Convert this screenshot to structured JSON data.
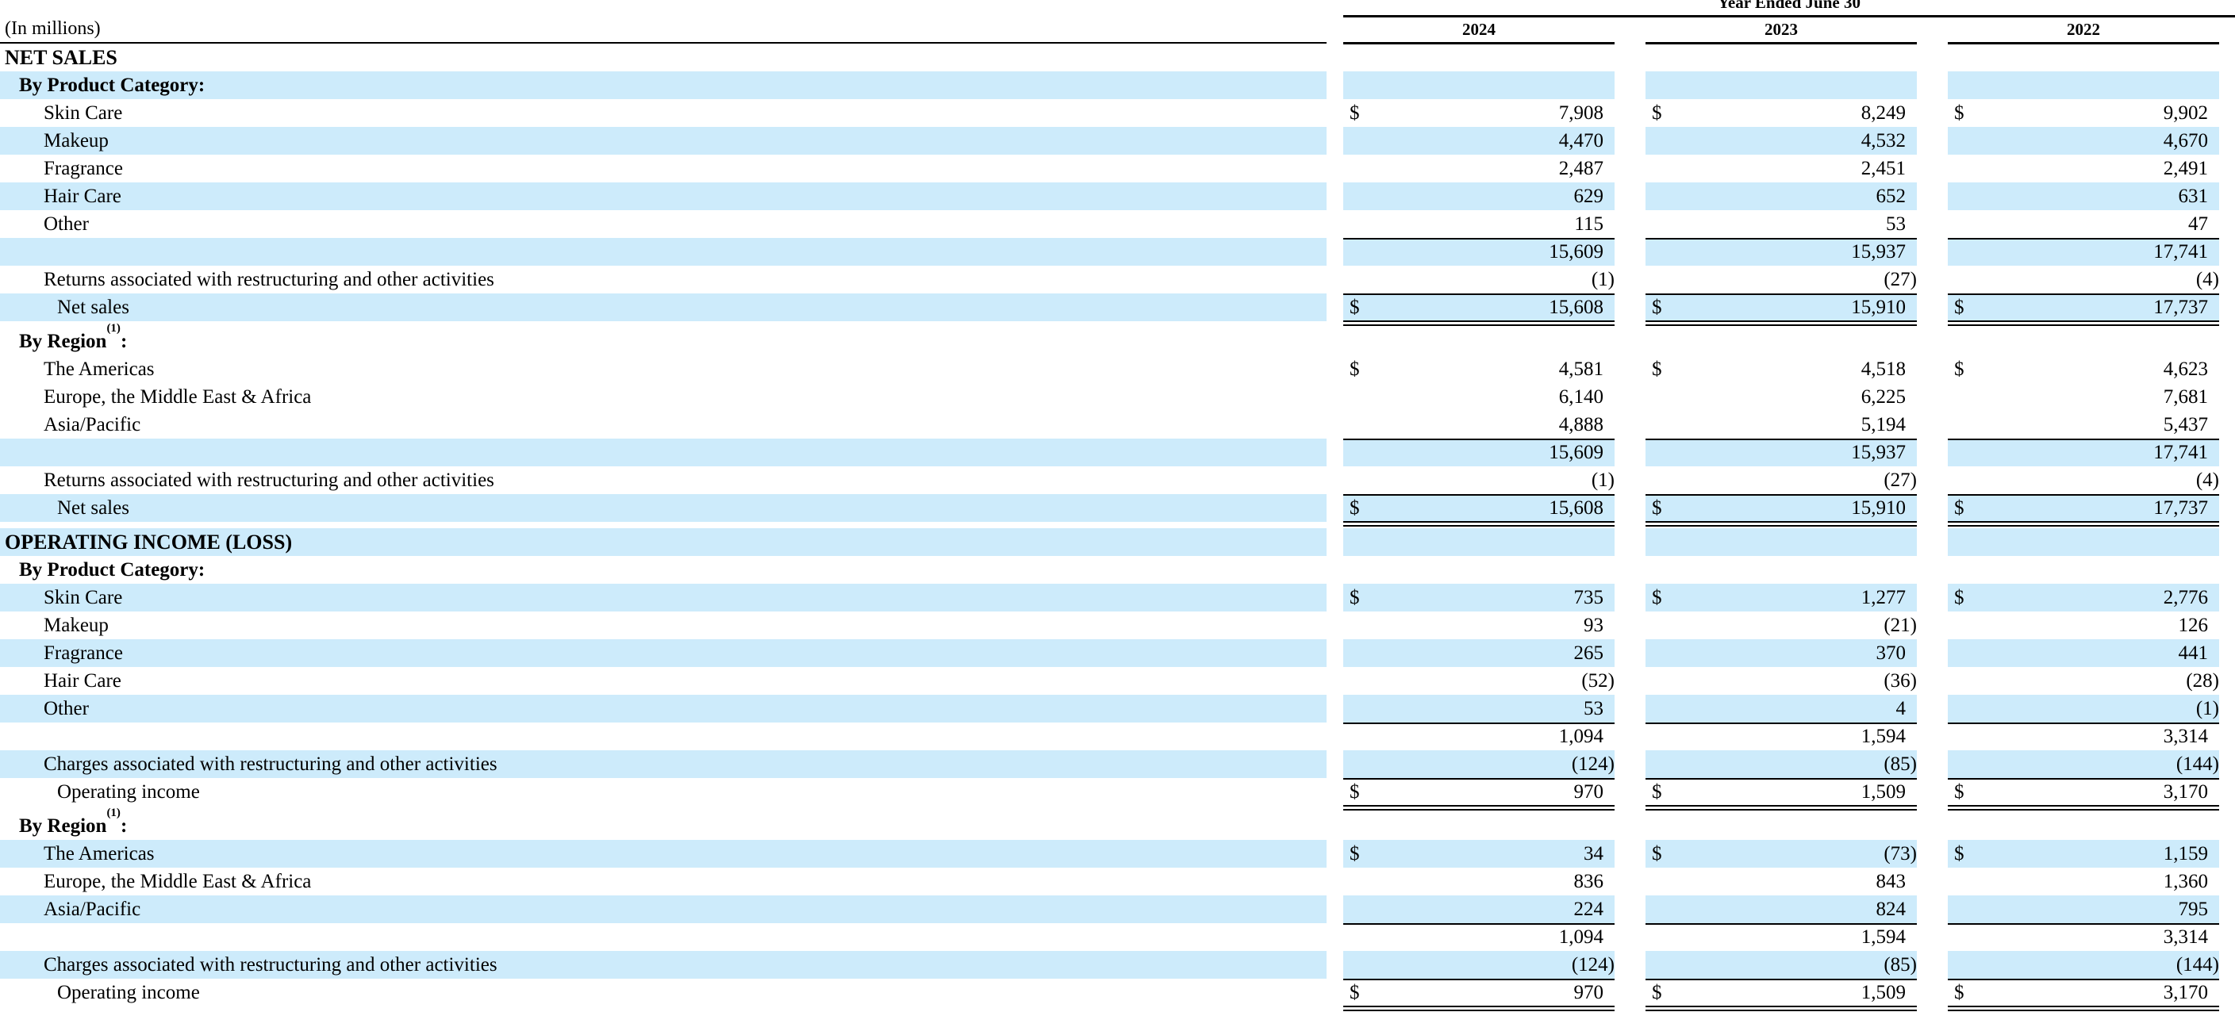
{
  "header": {
    "period_label": "Year Ended June 30",
    "unit_note": "(In millions)",
    "years": [
      "2024",
      "2023",
      "2022"
    ]
  },
  "rows": [
    {
      "type": "section",
      "label": "NET SALES",
      "shade": false
    },
    {
      "type": "subheader",
      "label": "By Product Category:",
      "shade": true
    },
    {
      "type": "item",
      "label": "Skin Care",
      "shade": false,
      "dollar": true,
      "values": [
        "7,908",
        "8,249",
        "9,902"
      ]
    },
    {
      "type": "item",
      "label": "Makeup",
      "shade": true,
      "values": [
        "4,470",
        "4,532",
        "4,670"
      ]
    },
    {
      "type": "item",
      "label": "Fragrance",
      "shade": false,
      "values": [
        "2,487",
        "2,451",
        "2,491"
      ]
    },
    {
      "type": "item",
      "label": "Hair Care",
      "shade": true,
      "values": [
        "629",
        "652",
        "631"
      ]
    },
    {
      "type": "item",
      "label": "Other",
      "shade": false,
      "values": [
        "115",
        "53",
        "47"
      ]
    },
    {
      "type": "item",
      "label": "",
      "shade": true,
      "rule_top": true,
      "values": [
        "15,609",
        "15,937",
        "17,741"
      ]
    },
    {
      "type": "item",
      "label": "Returns associated with restructuring and other activities",
      "shade": false,
      "values": [
        "(1)",
        "(27)",
        "(4)"
      ]
    },
    {
      "type": "total",
      "label": "Net sales",
      "shade": true,
      "dollar": true,
      "rule_top": true,
      "double": true,
      "values": [
        "15,608",
        "15,910",
        "17,737"
      ]
    },
    {
      "type": "subheader",
      "label": "By Region",
      "sup": "(1)",
      "suffix": ":",
      "shade": false
    },
    {
      "type": "item",
      "label": "The Americas",
      "shade": false,
      "dollar": true,
      "values": [
        "4,581",
        "4,518",
        "4,623"
      ]
    },
    {
      "type": "item",
      "label": "Europe, the Middle East & Africa",
      "shade": false,
      "values": [
        "6,140",
        "6,225",
        "7,681"
      ]
    },
    {
      "type": "item",
      "label": "Asia/Pacific",
      "shade": false,
      "values": [
        "4,888",
        "5,194",
        "5,437"
      ]
    },
    {
      "type": "item",
      "label": "",
      "shade": true,
      "rule_top": true,
      "values": [
        "15,609",
        "15,937",
        "17,741"
      ]
    },
    {
      "type": "item",
      "label": "Returns associated with restructuring and other activities",
      "shade": false,
      "values": [
        "(1)",
        "(27)",
        "(4)"
      ]
    },
    {
      "type": "total",
      "label": "Net sales",
      "shade": true,
      "dollar": true,
      "rule_top": true,
      "double": true,
      "values": [
        "15,608",
        "15,910",
        "17,737"
      ]
    },
    {
      "type": "section",
      "label": "OPERATING INCOME (LOSS)",
      "shade": true
    },
    {
      "type": "subheader",
      "label": "By Product Category:",
      "shade": false
    },
    {
      "type": "item",
      "label": "Skin Care",
      "shade": true,
      "dollar": true,
      "values": [
        "735",
        "1,277",
        "2,776"
      ]
    },
    {
      "type": "item",
      "label": "Makeup",
      "shade": false,
      "values": [
        "93",
        "(21)",
        "126"
      ]
    },
    {
      "type": "item",
      "label": "Fragrance",
      "shade": true,
      "values": [
        "265",
        "370",
        "441"
      ]
    },
    {
      "type": "item",
      "label": "Hair Care",
      "shade": false,
      "values": [
        "(52)",
        "(36)",
        "(28)"
      ]
    },
    {
      "type": "item",
      "label": "Other",
      "shade": true,
      "values": [
        "53",
        "4",
        "(1)"
      ]
    },
    {
      "type": "item",
      "label": "",
      "shade": false,
      "rule_top": true,
      "values": [
        "1,094",
        "1,594",
        "3,314"
      ]
    },
    {
      "type": "item",
      "label": "Charges associated with restructuring and other activities",
      "shade": true,
      "values": [
        "(124)",
        "(85)",
        "(144)"
      ]
    },
    {
      "type": "total",
      "label": "Operating income",
      "shade": false,
      "dollar": true,
      "rule_top": true,
      "double": true,
      "values": [
        "970",
        "1,509",
        "3,170"
      ]
    },
    {
      "type": "subheader",
      "label": "By Region",
      "sup": "(1)",
      "suffix": ":",
      "shade": false
    },
    {
      "type": "item",
      "label": "The Americas",
      "shade": true,
      "dollar": true,
      "values": [
        "34",
        "(73)",
        "1,159"
      ]
    },
    {
      "type": "item",
      "label": "Europe, the Middle East & Africa",
      "shade": false,
      "values": [
        "836",
        "843",
        "1,360"
      ]
    },
    {
      "type": "item",
      "label": "Asia/Pacific",
      "shade": true,
      "values": [
        "224",
        "824",
        "795"
      ]
    },
    {
      "type": "item",
      "label": "",
      "shade": false,
      "rule_top": true,
      "values": [
        "1,094",
        "1,594",
        "3,314"
      ]
    },
    {
      "type": "item",
      "label": "Charges associated with restructuring and other activities",
      "shade": true,
      "values": [
        "(124)",
        "(85)",
        "(144)"
      ]
    },
    {
      "type": "total",
      "label": "Operating income",
      "shade": false,
      "dollar": true,
      "rule_top": true,
      "double": true,
      "values": [
        "970",
        "1,509",
        "3,170"
      ]
    }
  ]
}
